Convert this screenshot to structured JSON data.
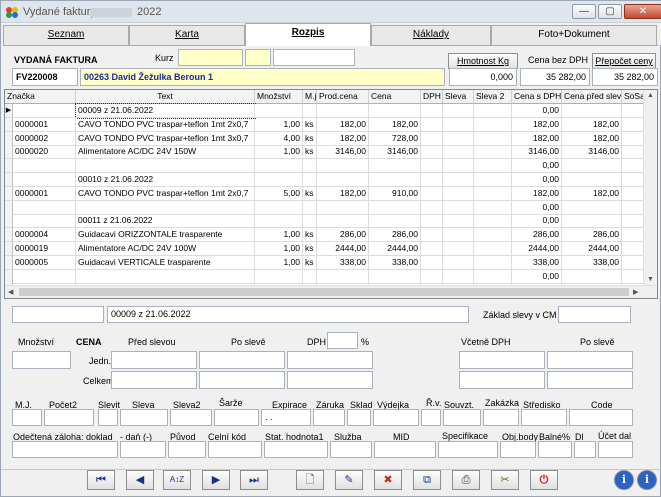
{
  "window": {
    "title": "Vydané faktury",
    "title_year": "2022",
    "minimize": "—",
    "maximize": "▢",
    "close": "✕"
  },
  "tabs": [
    {
      "label": "Seznam",
      "active": false
    },
    {
      "label": "Karta",
      "active": false
    },
    {
      "label": "Rozpis",
      "active": true
    },
    {
      "label": "Náklady",
      "active": false
    },
    {
      "label": "Foto+Dokument",
      "active": false
    }
  ],
  "header": {
    "vydana_faktura_label": "VYDANÁ FAKTURA",
    "kurz_label": "Kurz",
    "kurz_value": "",
    "invoice_number": "FV220008",
    "customer": "00263 David Žežulka  Beroun 1",
    "hmotnost_button": "Hmotnost Kg",
    "hmotnost_value": "0,000",
    "cena_bez_dph_label": "Cena bez DPH",
    "cena_bez_dph_value": "35 282,00",
    "prepocet_button": "Přepočet ceny",
    "prepocet_value": "35 282,00"
  },
  "grid": {
    "columns": [
      "Značka",
      "Text",
      "Množství",
      "M.j.",
      "Prod.cena",
      "Cena",
      "DPH",
      "Sleva",
      "Sleva 2",
      "Cena s DPH",
      "Cena před slevou",
      "SoSa"
    ],
    "rows": [
      {
        "znacka": "",
        "text": "00009 z 21.06.2022",
        "mnozstvi": "",
        "mj": "",
        "prodcena": "",
        "cena": "",
        "dph": "",
        "sleva": "",
        "sleva2": "",
        "cenasdph": "0,00",
        "cenapred": "",
        "selected": true
      },
      {
        "znacka": "0000001",
        "text": "CAVO TONDO PVC traspar+teflon 1mt 2x0,7",
        "mnozstvi": "1,00",
        "mj": "ks",
        "prodcena": "182,00",
        "cena": "182,00",
        "dph": "",
        "sleva": "",
        "sleva2": "",
        "cenasdph": "182,00",
        "cenapred": "182,00"
      },
      {
        "znacka": "0000002",
        "text": "CAVO TONDO PVC traspar+teflon 1mt 3x0,7",
        "mnozstvi": "4,00",
        "mj": "ks",
        "prodcena": "182,00",
        "cena": "728,00",
        "dph": "",
        "sleva": "",
        "sleva2": "",
        "cenasdph": "182,00",
        "cenapred": "182,00"
      },
      {
        "znacka": "0000020",
        "text": "Alimentatore AC/DC 24V 150W",
        "mnozstvi": "1,00",
        "mj": "ks",
        "prodcena": "3146,00",
        "cena": "3146,00",
        "dph": "",
        "sleva": "",
        "sleva2": "",
        "cenasdph": "3146,00",
        "cenapred": "3146,00"
      },
      {
        "znacka": "",
        "text": "",
        "mnozstvi": "",
        "mj": "",
        "prodcena": "",
        "cena": "",
        "dph": "",
        "sleva": "",
        "sleva2": "",
        "cenasdph": "0,00",
        "cenapred": ""
      },
      {
        "znacka": "",
        "text": "00010 z 21.06.2022",
        "mnozstvi": "",
        "mj": "",
        "prodcena": "",
        "cena": "",
        "dph": "",
        "sleva": "",
        "sleva2": "",
        "cenasdph": "0,00",
        "cenapred": ""
      },
      {
        "znacka": "0000001",
        "text": "CAVO TONDO PVC traspar+teflon 1mt 2x0,7",
        "mnozstvi": "5,00",
        "mj": "ks",
        "prodcena": "182,00",
        "cena": "910,00",
        "dph": "",
        "sleva": "",
        "sleva2": "",
        "cenasdph": "182,00",
        "cenapred": "182,00"
      },
      {
        "znacka": "",
        "text": "",
        "mnozstvi": "",
        "mj": "",
        "prodcena": "",
        "cena": "",
        "dph": "",
        "sleva": "",
        "sleva2": "",
        "cenasdph": "0,00",
        "cenapred": ""
      },
      {
        "znacka": "",
        "text": "00011 z 21.06.2022",
        "mnozstvi": "",
        "mj": "",
        "prodcena": "",
        "cena": "",
        "dph": "",
        "sleva": "",
        "sleva2": "",
        "cenasdph": "0,00",
        "cenapred": ""
      },
      {
        "znacka": "0000004",
        "text": "Guidacavi ORIZZONTALE trasparente",
        "mnozstvi": "1,00",
        "mj": "ks",
        "prodcena": "286,00",
        "cena": "286,00",
        "dph": "",
        "sleva": "",
        "sleva2": "",
        "cenasdph": "286,00",
        "cenapred": "286,00"
      },
      {
        "znacka": "0000019",
        "text": "Alimentatore AC/DC 24V 100W",
        "mnozstvi": "1,00",
        "mj": "ks",
        "prodcena": "2444,00",
        "cena": "2444,00",
        "dph": "",
        "sleva": "",
        "sleva2": "",
        "cenasdph": "2444,00",
        "cenapred": "2444,00"
      },
      {
        "znacka": "0000005",
        "text": "Guidacavi VERTICALE trasparente",
        "mnozstvi": "1,00",
        "mj": "ks",
        "prodcena": "338,00",
        "cena": "338,00",
        "dph": "",
        "sleva": "",
        "sleva2": "",
        "cenasdph": "338,00",
        "cenapred": "338,00"
      },
      {
        "znacka": "",
        "text": "",
        "mnozstvi": "",
        "mj": "",
        "prodcena": "",
        "cena": "",
        "dph": "",
        "sleva": "",
        "sleva2": "",
        "cenasdph": "0,00",
        "cenapred": ""
      },
      {
        "znacka": "",
        "text": "",
        "mnozstvi": "",
        "mj": "",
        "prodcena": "",
        "cena": "",
        "dph": "",
        "sleva": "",
        "sleva2": "",
        "cenasdph": "",
        "cenapred": ""
      }
    ]
  },
  "detail": {
    "znacka_value": "",
    "text_value": "00009 z 21.06.2022",
    "zaklad_slevy_label": "Základ slevy v CM",
    "zaklad_slevy_value": "",
    "mnozstvi_label": "Množství",
    "cena_label": "CENA",
    "pred_slevou_label": "Před slevou",
    "po_sleve_label": "Po slevě",
    "dph_label": "DPH",
    "percent": "%",
    "vcetne_dph_label": "Včetně DPH",
    "po_sleve2_label": "Po slevě",
    "jedn_label": "Jedn.",
    "celkem_label": "Celkem",
    "expirace_value": ". .",
    "fields_row1": [
      "M.J.",
      "Počet2",
      "Slevit",
      "Sleva",
      "Sleva2",
      "Šarže",
      "Expirace",
      "Záruka",
      "Sklad",
      "Výdejka",
      "Ř.v.",
      "Souvzt.",
      "Zakázka",
      "Středisko",
      "Code"
    ],
    "fields_row2": [
      "Odečtená záloha: doklad",
      "- daň (-)",
      "Původ",
      "Celní kód",
      "Stat. hodnota1",
      "Služba",
      "MID",
      "Specifikace",
      "Obj.body",
      "Balné%",
      "Dl",
      "Účet dal"
    ]
  },
  "toolbar": {
    "first": "⏮",
    "prev": "◀",
    "sort": "A↕Z",
    "next": "▶",
    "last": "⏭",
    "new": "🗋",
    "edit": "✎",
    "delete": "✖",
    "copy": "⧉",
    "print": "⎙",
    "tools": "✂",
    "exit": "⏻",
    "info": "i",
    "help": "i"
  },
  "colors": {
    "yellow_field": "#ffffc8",
    "customer_text": "#1a2a9a",
    "exit_red": "#d32020"
  }
}
